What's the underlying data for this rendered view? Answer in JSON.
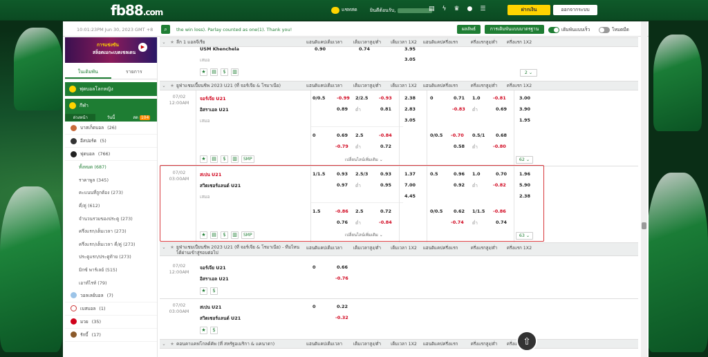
{
  "header": {
    "logo": "fb88",
    "logo_suffix": ".com",
    "chat_label": "แชทสด",
    "welcome": "ยินดีต้อนรับ,",
    "icons": [
      "card-icon",
      "lightning-icon",
      "cup-icon",
      "profile-icon",
      "list-icon"
    ],
    "deposit_label": "ฝากเงิน",
    "logout_label": "ออกจากระบบ"
  },
  "toolbar": {
    "clock": "10:01:23PM Jun 30, 2023 GMT +8",
    "ticker": "the win loss). Parlay counted as one(1). Thank you!",
    "results_label": "ผลลัพธ์",
    "settings_label": "การเดิมพันแบบมาตรฐาน",
    "quick_bet_label": "เดิมพันแบบเร็ว",
    "quick_bet_on": true,
    "night_mode_label": "โหมดมืด",
    "night_mode_on": false
  },
  "sidebar": {
    "banner_text1": "การแข่งขัน",
    "banner_text2": "สล็อตเมกะเบตเชลเดน",
    "tab_today": "ในเดิมพัน",
    "tab_list": "รายการ",
    "section_worldcup": "ฟุตบอลโลกหญิง",
    "section_sports": "กีฬา",
    "day_tabs": [
      "ล่วงหน้า",
      "วันนี้",
      "สด"
    ],
    "live_count": "104",
    "items": [
      {
        "label": "บาสเก็ตบอล",
        "count": "(26)"
      },
      {
        "label": "อีสปอร์ต",
        "count": "(5)"
      },
      {
        "label": "ฟุตบอล",
        "count": "(766)"
      }
    ],
    "sub_items": [
      {
        "label": "ทั้งหมด",
        "count": "(687)"
      },
      {
        "label": "ราคาพูล",
        "count": "(345)"
      },
      {
        "label": "คะแนนที่ถูกต้อง",
        "count": "(273)"
      },
      {
        "label": "คี่/คู่",
        "count": "(612)"
      },
      {
        "label": "จำนวนรวมของประตู",
        "count": "(273)"
      },
      {
        "label": "ครึ่งแรก/เต็มเวลา",
        "count": "(273)"
      },
      {
        "label": "ครึ่งแรก/เต็มเวลา คี่/คู่",
        "count": "(273)"
      },
      {
        "label": "ประตูแรก/ประตูท้าย",
        "count": "(273)"
      },
      {
        "label": "มิกซ์ พาร์เลย์",
        "count": "(515)"
      },
      {
        "label": "เอาท์ไรท์",
        "count": "(79)"
      }
    ],
    "items_bottom": [
      {
        "label": "วอลเลย์บอล",
        "count": "(7)"
      },
      {
        "label": "เบสบอล",
        "count": "(1)"
      },
      {
        "label": "มวย",
        "count": "(35)"
      },
      {
        "label": "รักบี้",
        "count": "(17)"
      }
    ]
  },
  "columns": [
    "แฮนดิแคปเต็มเวลา",
    "เต็มเวลาสูง/ต่ำ",
    "เต็มเวลา 1X2",
    "แฮนดิแคปครึ่งแรก",
    "ครึ่งแรกสูง/ต่ำ",
    "ครึ่งแรก 1X2"
  ],
  "leagues": {
    "l1": "ลีก 1 แอลจีเรีย",
    "l2": "ยูฟ่าแชมเปี้ยนชิพ 2023 U21 (ที่ จอร์เจีย & โรมาเนีย)",
    "l3": "ยูฟ่าแชมเปี้ยนชิพ 2023 U21 (ที่ จอร์เจีย & โรมาเนีย) - ทีมไหนได้ผ่านเข้าสู่รอบต่อไป",
    "l4": "คอนคาแคฟโกลด์คัพ (ที่ สหรัฐอเมริกา & แคนาดา)"
  },
  "m0": {
    "team": "USM Khenchela",
    "draw": "เสมอ",
    "v": [
      "0.90",
      "0.74",
      "3.95",
      "3.05"
    ],
    "count": "2"
  },
  "m1": {
    "date": "07/02",
    "time": "12:00AM",
    "home": "จอร์เจีย U21",
    "away": "อิสราเอล U21",
    "draw": "เสมอ",
    "hdp": "0/0.5",
    "hdp_h": "-0.99",
    "hdp_a": "0.89",
    "ou": "2/2.5",
    "ou_o": "-0.93",
    "ou_u": "0.81",
    "under": "ต่ำ",
    "x1": "2.38",
    "x2": "2.83",
    "xd": "3.05",
    "fh_hdp": "0",
    "fh_h": "0.71",
    "fh_a": "-0.83",
    "fh_ou": "1.0",
    "fh_o": "-0.81",
    "fh_u": "0.69",
    "fx1": "3.00",
    "fx2": "3.90",
    "fxd": "1.95",
    "alt_hdp": "0",
    "alt_h": "0.69",
    "alt_a": "-0.79",
    "alt_ou": "2.5",
    "alt_o": "-0.84",
    "alt_u": "0.72",
    "alt_fh": "0/0.5",
    "alt_fh_h": "-0.70",
    "alt_fh_a": "0.58",
    "alt_fh_ou": "0.5/1",
    "alt_fh_o": "0.68",
    "alt_fh_u": "-0.80",
    "more": "เปลี่ยนไลน์เพิ่มเติม",
    "smp": "SMP",
    "count": "62"
  },
  "m2": {
    "date": "07/02",
    "time": "03:00AM",
    "home": "สเปน U21",
    "away": "สวิตเซอร์แลนด์ U21",
    "draw": "เสมอ",
    "hdp": "1/1.5",
    "hdp_h": "0.93",
    "hdp_a": "0.97",
    "ou": "2.5/3",
    "ou_o": "0.93",
    "ou_u": "0.95",
    "under": "ต่ำ",
    "x1": "1.37",
    "x2": "7.00",
    "xd": "4.45",
    "fh_hdp": "0.5",
    "fh_h": "0.96",
    "fh_a": "0.92",
    "fh_ou": "1.0",
    "fh_o": "0.70",
    "fh_u": "-0.82",
    "fx1": "1.96",
    "fx2": "5.90",
    "fxd": "2.38",
    "alt_hdp": "1.5",
    "alt_h": "-0.86",
    "alt_a": "0.76",
    "alt_ou": "2.5",
    "alt_o": "0.72",
    "alt_u": "-0.84",
    "alt_fh": "0/0.5",
    "alt_fh_h": "0.62",
    "alt_fh_a": "-0.74",
    "alt_fh_ou": "1/1.5",
    "alt_fh_o": "-0.86",
    "alt_fh_u": "0.74",
    "more": "เปลี่ยนไลน์เพิ่มเติม",
    "smp": "SMP",
    "count": "63"
  },
  "m3": {
    "date": "07/02",
    "time": "12:00AM",
    "home": "จอร์เจีย U21",
    "away": "อิสราเอล U21",
    "line": "0",
    "v1": "0.66",
    "v2": "-0.76"
  },
  "m4": {
    "date": "07/02",
    "time": "03:00AM",
    "home": "สเปน U21",
    "away": "สวิตเซอร์แลนด์ U21",
    "line": "0",
    "v1": "0.22",
    "v2": "-0.32"
  }
}
